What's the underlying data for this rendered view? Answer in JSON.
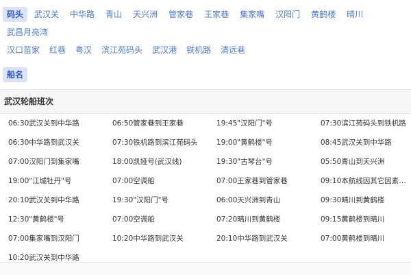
{
  "tabs": {
    "primary_active": "码头",
    "row1": [
      "武汉关",
      "中华路",
      "青山",
      "天兴洲",
      "管家巷",
      "王家巷",
      "集家嘴",
      "汉阳门",
      "黄鹤楼",
      "晴川",
      "武昌月亮湾"
    ],
    "row2": [
      "汉口苗家",
      "红巷",
      "粤汉",
      "滨江苑码头",
      "武汉港",
      "铁机路",
      "清远巷"
    ],
    "secondary_active": "船名"
  },
  "schedule": {
    "title": "武汉轮船班次",
    "items": [
      "06:30武汉关到中华路",
      "06:50管家巷到王家巷",
      "19:45\"汉阳门\"号",
      "07:30滨江苑码头到铁机路",
      "06:30中华路到武汉关",
      "07:30铁机路到滨江苑码头",
      "19:00\"黄鹤楼\"号",
      "08:45武汉关到中华路",
      "07:00汉阳门到集家嘴",
      "18:00凯娅号(武汉线)",
      "19:30\"古琴台\"号",
      "05:50青山到天兴洲",
      "19:00\"江城牡丹\"号",
      "07:00空调船",
      "07:00王家巷到管家巷",
      "09:10本航线因其它因素原因...",
      "20:10武汉关到中华路",
      "19:30\"汉阳门\"号",
      "06:00天兴洲到青山",
      "09:30晴川到黄鹤楼",
      "12:30\"黄鹤楼\"号",
      "07:00空调船",
      "07:20晴川到黄鹤楼",
      "09:15黄鹤楼到晴川",
      "07:00集家嘴到汉阳门",
      "10:20中华路到武汉关",
      "20:10中华路到武汉关",
      "07:00黄鹤楼到晴川",
      "10:20武汉关到中华路"
    ]
  }
}
